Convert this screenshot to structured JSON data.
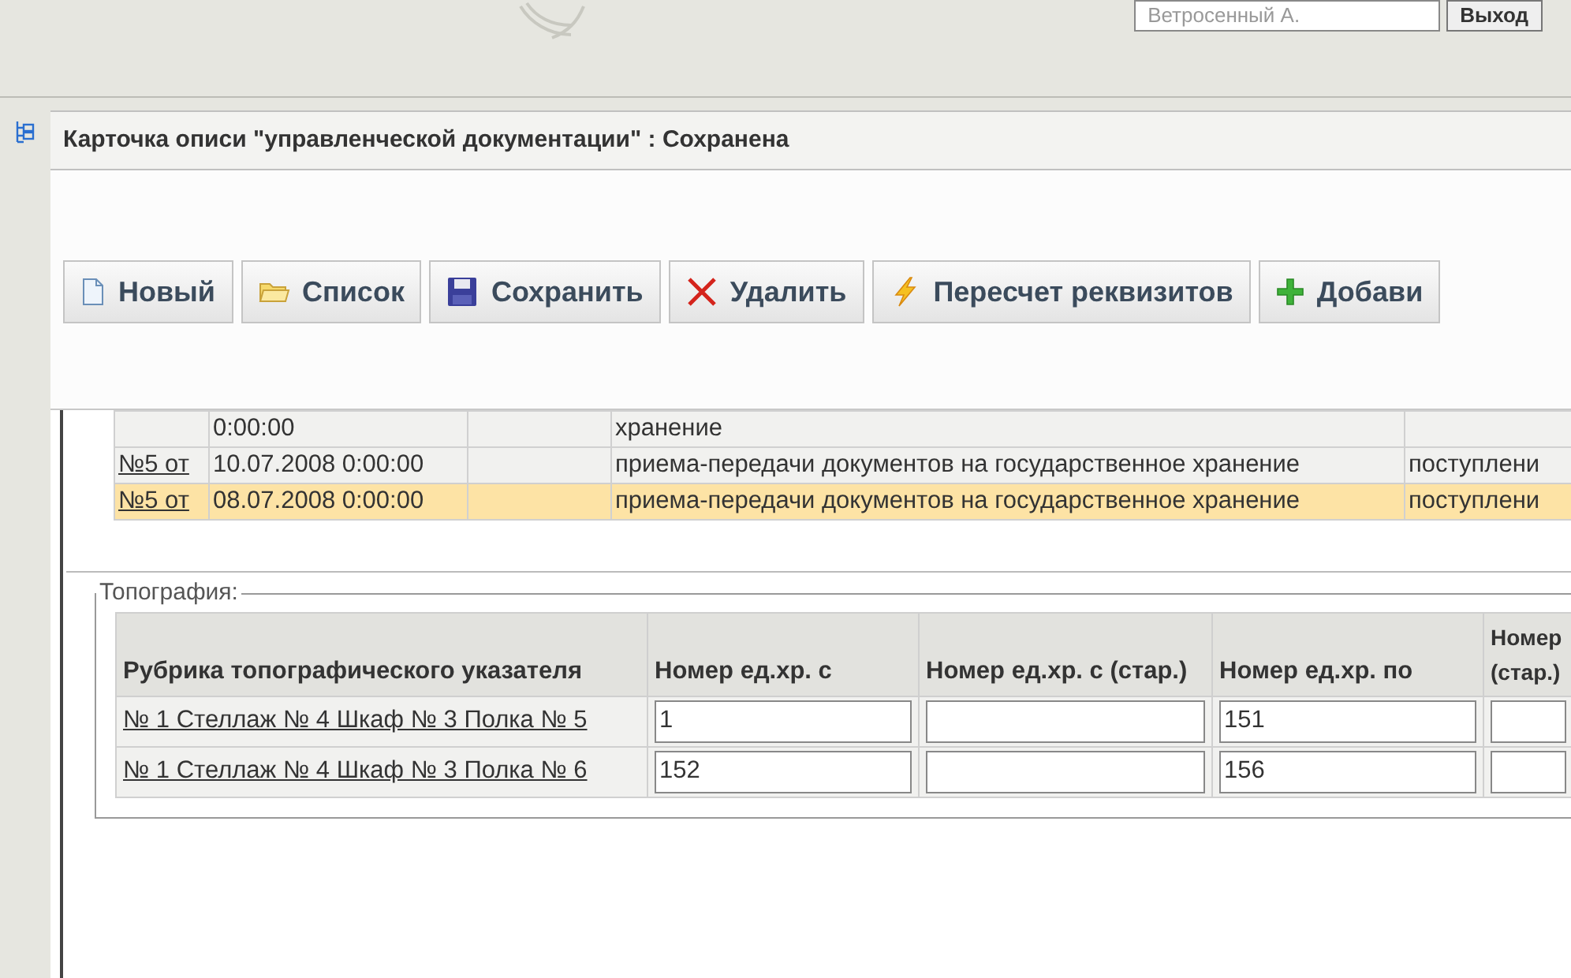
{
  "header": {
    "user_field": {
      "value": "Ветросенный А."
    },
    "logout_button": "Выход"
  },
  "panel": {
    "title": "Карточка описи \"управленческой документации\" : Сохранена"
  },
  "toolbar": [
    {
      "label": "Новый",
      "kind": "new"
    },
    {
      "label": "Список",
      "kind": "list"
    },
    {
      "label": "Сохранить",
      "kind": "save"
    },
    {
      "label": "Удалить",
      "kind": "delete"
    },
    {
      "label": "Пересчет реквизитов",
      "kind": "recalc"
    },
    {
      "label": "Добави",
      "kind": "add"
    }
  ],
  "documents": {
    "rows": [
      {
        "number": "",
        "date": "0:00:00",
        "column_3": "",
        "description": "хранение",
        "type": "",
        "selected": false
      },
      {
        "number": "№5 от",
        "date": "10.07.2008 0:00:00",
        "column_3": "",
        "description": "приема-передачи документов на государственное хранение",
        "type": "поступлени",
        "selected": false
      },
      {
        "number": "№5 от",
        "date": "08.07.2008 0:00:00",
        "column_3": "",
        "description": "приема-передачи документов на государственное хранение",
        "type": "поступлени",
        "selected": true
      }
    ]
  },
  "topography": {
    "legend": "Топография:",
    "columns": [
      "Рубрика топографического указателя",
      "Номер ед.хр. с",
      "Номер ед.хр. с (стар.)",
      "Номер ед.хр. по",
      "Номер (стар.)"
    ],
    "rows": [
      {
        "rubric": "№ 1 Стеллаж № 4 Шкаф № 3 Полка № 5",
        "from": "1",
        "from_old": "",
        "to": "151",
        "to_old": ""
      },
      {
        "rubric": "№ 1 Стеллаж № 4 Шкаф № 3 Полка № 6",
        "from": "152",
        "from_old": "",
        "to": "156",
        "to_old": ""
      }
    ]
  }
}
